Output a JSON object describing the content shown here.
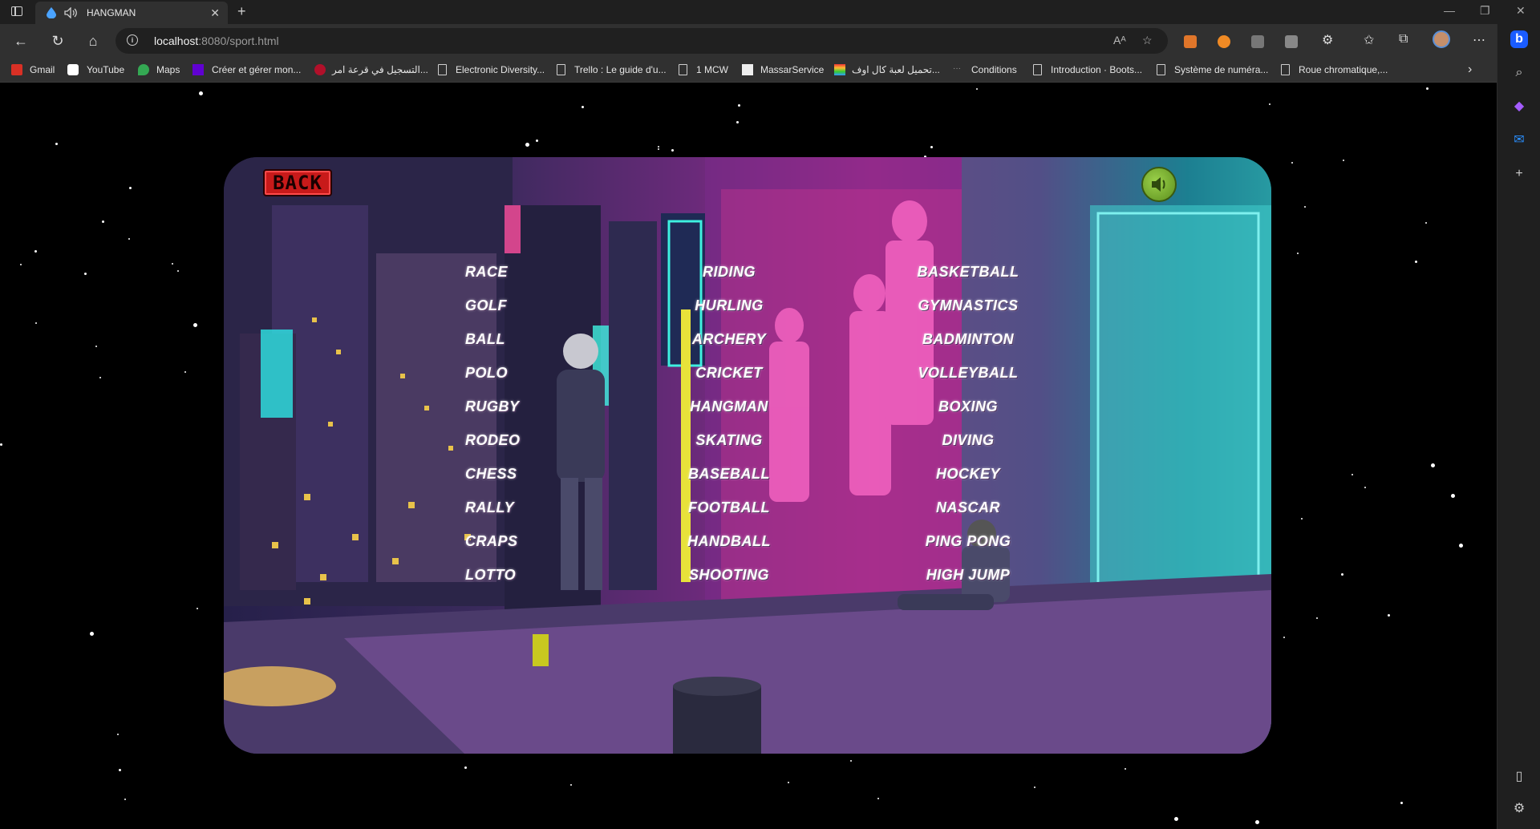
{
  "browser": {
    "tab": {
      "title": "HANGMAN",
      "close": "✕"
    },
    "new_tab": "+",
    "window_controls": {
      "minimize": "—",
      "restore": "❐",
      "close": "✕"
    },
    "address": {
      "host": "localhost",
      "rest": ":8080/sport.html"
    },
    "icons": [
      "back-icon",
      "refresh-icon",
      "home-icon",
      "info-icon",
      "read-aloud-icon",
      "favorite-add-icon",
      "favorites-icon",
      "collections-icon",
      "more-icon",
      "bing-icon"
    ],
    "bookmarks": [
      {
        "label": "Gmail",
        "icon": "gmail-icon"
      },
      {
        "label": "YouTube",
        "icon": "youtube-icon"
      },
      {
        "label": "Maps",
        "icon": "maps-icon"
      },
      {
        "label": "Créer et gérer mon...",
        "icon": "yahoo-icon"
      },
      {
        "label": "التسجيل في قرعة امر...",
        "icon": "flag-icon"
      },
      {
        "label": "Electronic Diversity...",
        "icon": "page-icon"
      },
      {
        "label": "Trello : Le guide d'u...",
        "icon": "page-icon"
      },
      {
        "label": "1 MCW",
        "icon": "page-icon"
      },
      {
        "label": "MassarService",
        "icon": "massar-icon"
      },
      {
        "label": "تحميل لعبة كال اوف...",
        "icon": "rainbow-icon"
      },
      {
        "label": "Conditions",
        "icon": "dots-icon"
      },
      {
        "label": "Introduction · Boots...",
        "icon": "page-icon"
      },
      {
        "label": "Système de numéra...",
        "icon": "page-icon"
      },
      {
        "label": "Roue chromatique,...",
        "icon": "page-icon"
      }
    ],
    "bookmarks_more": "›"
  },
  "game": {
    "back_label": "BACK",
    "sound_icon": "speaker-icon",
    "columns": [
      [
        "RACE",
        "GOLF",
        "BALL",
        "POLO",
        "RUGBY",
        "RODEO",
        "CHESS",
        "RALLY",
        "CRAPS",
        "LOTTO"
      ],
      [
        "RIDING",
        "HURLING",
        "ARCHERY",
        "CRICKET",
        "HANGMAN",
        "SKATING",
        "BASEBALL",
        "FOOTBALL",
        "HANDBALL",
        "SHOOTING"
      ],
      [
        "BASKETBALL",
        "GYMNASTICS",
        "BADMINTON",
        "VOLLEYBALL",
        "BOXING",
        "DIVING",
        "HOCKEY",
        "NASCAR",
        "PING  PONG",
        "HIGH JUMP"
      ]
    ]
  },
  "colors": {
    "tab_bg": "#1f1f1f",
    "toolbar_bg": "#303030",
    "back_red": "#c81a1a",
    "sound_green": "#7ab534"
  }
}
